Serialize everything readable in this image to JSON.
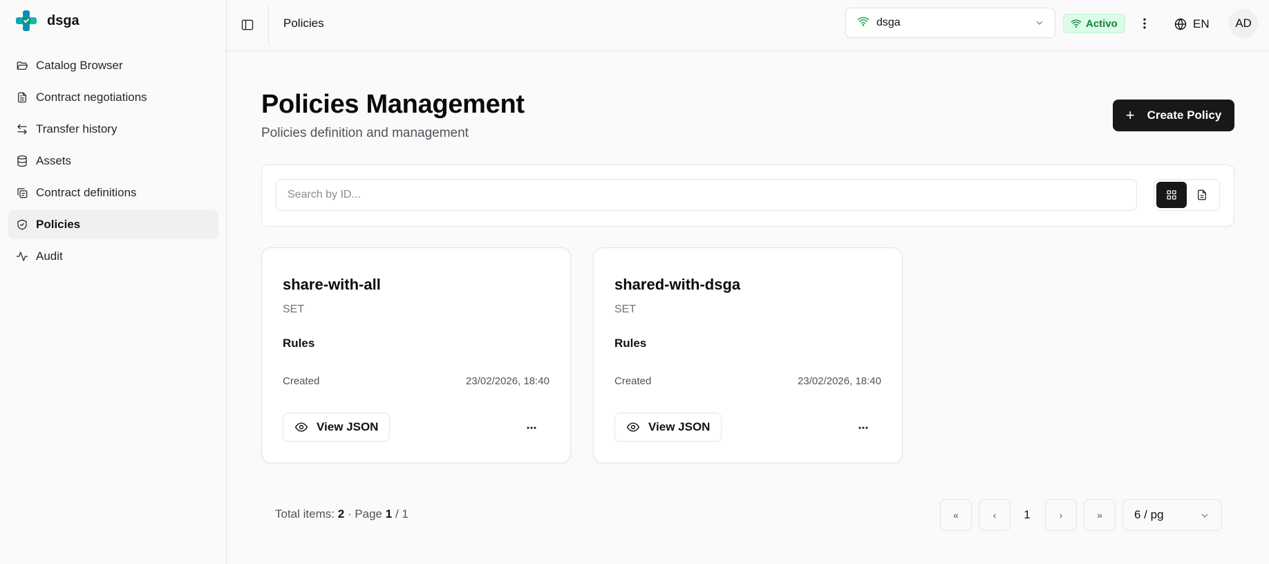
{
  "app": {
    "name": "dsga",
    "accent_color": "#18181b",
    "logo_colors": [
      "#0ea5b7",
      "#14b8a6"
    ]
  },
  "sidebar": {
    "items": [
      {
        "label": "Catalog Browser",
        "icon": "folder-open-icon",
        "active": false
      },
      {
        "label": "Contract negotiations",
        "icon": "document-icon",
        "active": false
      },
      {
        "label": "Transfer history",
        "icon": "arrows-left-right-icon",
        "active": false
      },
      {
        "label": "Assets",
        "icon": "database-icon",
        "active": false
      },
      {
        "label": "Contract definitions",
        "icon": "copy-contract-icon",
        "active": false
      },
      {
        "label": "Policies",
        "icon": "shield-check-icon",
        "active": true
      },
      {
        "label": "Audit",
        "icon": "activity-icon",
        "active": false
      }
    ]
  },
  "topbar": {
    "title": "Policies",
    "connector": {
      "value": "dsga",
      "icon": "wifi-icon"
    },
    "status": {
      "label": "Activo",
      "color": "#15803d"
    },
    "language": "EN",
    "avatar": "AD"
  },
  "page": {
    "title": "Policies Management",
    "subtitle": "Policies definition and management",
    "create_button": "Create Policy"
  },
  "search": {
    "placeholder": "Search by ID...",
    "value": "",
    "view_mode": "grid"
  },
  "cards": [
    {
      "title": "share-with-all",
      "type": "SET",
      "rules_label": "Rules",
      "created_label": "Created",
      "created_value": "23/02/2026, 18:40",
      "json_button": "View JSON"
    },
    {
      "title": "shared-with-dsga",
      "type": "SET",
      "rules_label": "Rules",
      "created_label": "Created",
      "created_value": "23/02/2026, 18:40",
      "json_button": "View JSON"
    }
  ],
  "pagination": {
    "total_label": "Total items:",
    "total": "2",
    "page_label": "· Page",
    "current": "1",
    "separator": "/ 1",
    "first": "«",
    "prev": "‹",
    "page_number": "1",
    "next": "›",
    "last": "»",
    "page_size": "6 / pg"
  }
}
